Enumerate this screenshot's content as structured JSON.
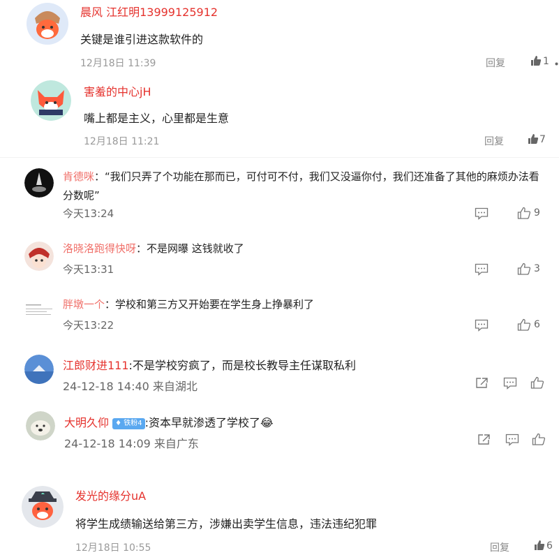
{
  "comments": [
    {
      "user": "晨风 江红明13999125912",
      "text": "关键是谁引进这款软件的",
      "time": "12月18日 11:39",
      "reply": "回复",
      "likes": "1"
    },
    {
      "user": "害羞的中心jH",
      "text": "嘴上都是主义，心里都是生意",
      "time": "12月18日 11:21",
      "reply": "回复",
      "likes": "7"
    },
    {
      "user": "肯德咪",
      "separator": "：",
      "text": "“我们只弄了个功能在那而已，可付可不付，我们又没逼你付，我们还准备了其他的麻烦办法看分数呢”",
      "time": "今天13:24",
      "likes": "9"
    },
    {
      "user": "洛晓洛跑得快呀",
      "separator": "：",
      "text": "不是网曝 这钱就收了",
      "time": "今天13:31",
      "likes": "3"
    },
    {
      "user": "胖墩一个",
      "separator": "：",
      "text": "学校和第三方又开始要在学生身上挣暴利了",
      "time": "今天13:22",
      "likes": "6"
    },
    {
      "user": "江郎财进111",
      "text": ":不是学校穷疯了，而是校长教导主任谋取私利",
      "time": "24-12-18 14:40 来自湖北"
    },
    {
      "user": "大明久仰",
      "badge": "铁粉4",
      "text": ":资本早就渗透了学校了",
      "emoji": "😂",
      "time": "24-12-18 14:09 来自广东"
    },
    {
      "user": "发光的缘分uA",
      "text": "将学生成绩输送给第三方，涉嫌出卖学生信息，违法违纪犯罪",
      "time": "12月18日 10:55",
      "reply": "回复",
      "likes": "6"
    }
  ],
  "colors": {
    "accent_red": "#e5322d",
    "accent_pink": "#f0706a",
    "text": "#222222",
    "muted": "#999999"
  },
  "icons": {
    "like": "thumbs-up-icon",
    "comment": "comment-icon",
    "share": "share-icon",
    "more": "more-dots-icon"
  }
}
